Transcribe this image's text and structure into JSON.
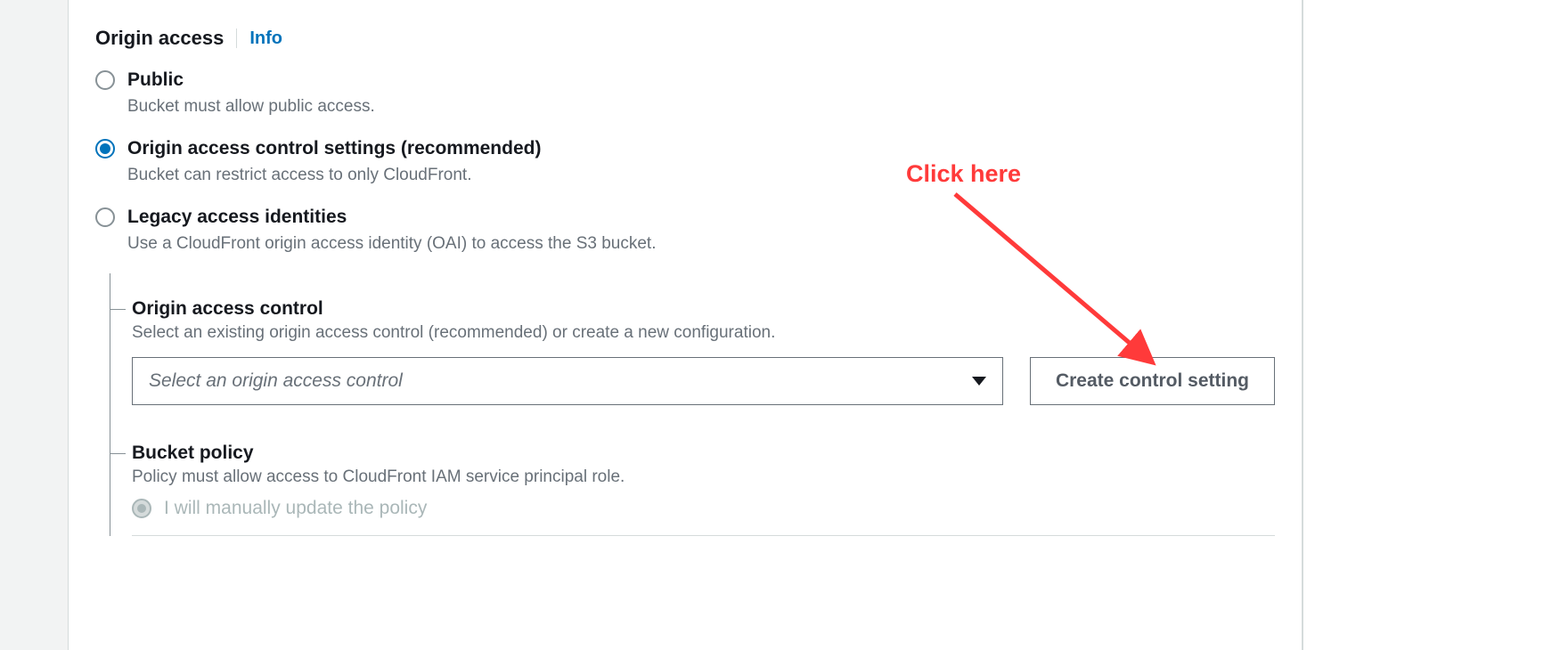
{
  "header": {
    "title": "Origin access",
    "info": "Info"
  },
  "options": {
    "public": {
      "label": "Public",
      "desc": "Bucket must allow public access."
    },
    "oac": {
      "label": "Origin access control settings (recommended)",
      "desc": "Bucket can restrict access to only CloudFront."
    },
    "legacy": {
      "label": "Legacy access identities",
      "desc": "Use a CloudFront origin access identity (OAI) to access the S3 bucket."
    }
  },
  "oac_section": {
    "title": "Origin access control",
    "desc": "Select an existing origin access control (recommended) or create a new configuration.",
    "select_placeholder": "Select an origin access control",
    "create_button": "Create control setting"
  },
  "bucket_policy": {
    "title": "Bucket policy",
    "desc": "Policy must allow access to CloudFront IAM service principal role.",
    "manual_option": "I will manually update the policy"
  },
  "annotation": {
    "text": "Click here",
    "color": "#ff3a3a"
  }
}
